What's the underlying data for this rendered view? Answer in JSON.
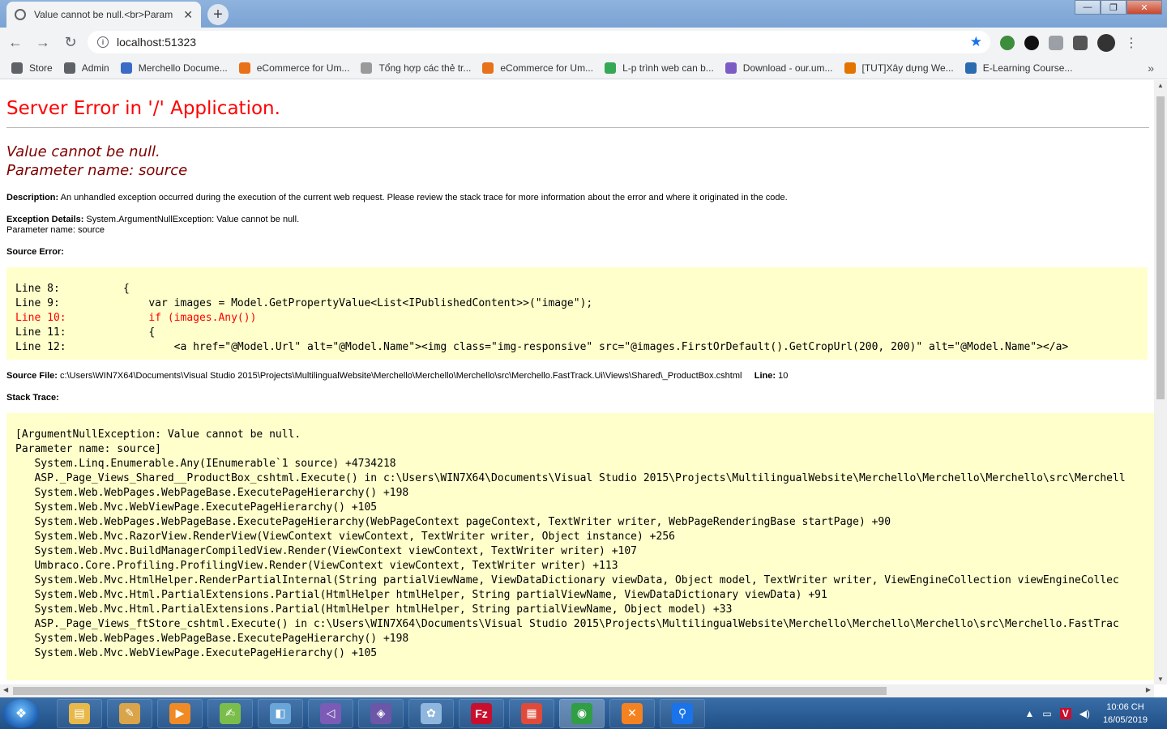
{
  "browser": {
    "tab_title": "Value cannot be null.<br>Param",
    "tab_close": "✕",
    "new_tab": "+",
    "url": "localhost:51323",
    "info": "i",
    "back": "←",
    "forward": "→",
    "reload": "↻",
    "star": "★",
    "menu": "⋮",
    "window_min": "—",
    "window_max": "❐",
    "window_close": "✕"
  },
  "bookmarks": [
    {
      "label": "Store",
      "color": "#5f6368"
    },
    {
      "label": "Admin",
      "color": "#5f6368"
    },
    {
      "label": "Merchello Docume...",
      "color": "#3b6bc5"
    },
    {
      "label": "eCommerce for Um...",
      "color": "#e8711a"
    },
    {
      "label": "Tổng hợp các thẻ tr...",
      "color": "#9a9a9a"
    },
    {
      "label": "eCommerce for Um...",
      "color": "#e8711a"
    },
    {
      "label": "L-p trình web can b...",
      "color": "#34a853"
    },
    {
      "label": "Download - our.um...",
      "color": "#7c5cc4"
    },
    {
      "label": "[TUT]Xây dựng We...",
      "color": "#e37400"
    },
    {
      "label": "E-Learning Course...",
      "color": "#2b6cb0"
    }
  ],
  "bookmarks_more": "»",
  "page": {
    "title": "Server Error in '/' Application.",
    "message_line1": "Value cannot be null.",
    "message_line2": "Parameter name: source",
    "description_label": "Description:",
    "description_text": " An unhandled exception occurred during the execution of the current web request. Please review the stack trace for more information about the error and where it originated in the code.",
    "exception_label": "Exception Details:",
    "exception_text": " System.ArgumentNullException: Value cannot be null.",
    "exception_param": "Parameter name: source",
    "source_error_label": "Source Error:",
    "source_lines": [
      {
        "text": "Line 8:          {",
        "highlight": false
      },
      {
        "text": "Line 9:              var images = Model.GetPropertyValue<List<IPublishedContent>>(\"image\");",
        "highlight": false
      },
      {
        "text": "Line 10:             if (images.Any())",
        "highlight": true
      },
      {
        "text": "Line 11:             {",
        "highlight": false
      },
      {
        "text": "Line 12:                 <a href=\"@Model.Url\" alt=\"@Model.Name\"><img class=\"img-responsive\" src=\"@images.FirstOrDefault().GetCropUrl(200, 200)\" alt=\"@Model.Name\"></a>",
        "highlight": false
      }
    ],
    "source_file_label": "Source File:",
    "source_file_path": " c:\\Users\\WIN7X64\\Documents\\Visual Studio 2015\\Projects\\MultilingualWebsite\\Merchello\\Merchello\\Merchello\\src\\Merchello.FastTrack.Ui\\Views\\Shared\\_ProductBox.cshtml",
    "line_label": "Line:",
    "line_value": " 10",
    "stack_trace_label": "Stack Trace:",
    "stack_lines": [
      "[ArgumentNullException: Value cannot be null.",
      "Parameter name: source]",
      "   System.Linq.Enumerable.Any(IEnumerable`1 source) +4734218",
      "   ASP._Page_Views_Shared__ProductBox_cshtml.Execute() in c:\\Users\\WIN7X64\\Documents\\Visual Studio 2015\\Projects\\MultilingualWebsite\\Merchello\\Merchello\\Merchello\\src\\Merchell",
      "   System.Web.WebPages.WebPageBase.ExecutePageHierarchy() +198",
      "   System.Web.Mvc.WebViewPage.ExecutePageHierarchy() +105",
      "   System.Web.WebPages.WebPageBase.ExecutePageHierarchy(WebPageContext pageContext, TextWriter writer, WebPageRenderingBase startPage) +90",
      "   System.Web.Mvc.RazorView.RenderView(ViewContext viewContext, TextWriter writer, Object instance) +256",
      "   System.Web.Mvc.BuildManagerCompiledView.Render(ViewContext viewContext, TextWriter writer) +107",
      "   Umbraco.Core.Profiling.ProfilingView.Render(ViewContext viewContext, TextWriter writer) +113",
      "   System.Web.Mvc.HtmlHelper.RenderPartialInternal(String partialViewName, ViewDataDictionary viewData, Object model, TextWriter writer, ViewEngineCollection viewEngineCollec",
      "   System.Web.Mvc.Html.PartialExtensions.Partial(HtmlHelper htmlHelper, String partialViewName, ViewDataDictionary viewData) +91",
      "   System.Web.Mvc.Html.PartialExtensions.Partial(HtmlHelper htmlHelper, String partialViewName, Object model) +33",
      "   ASP._Page_Views_ftStore_cshtml.Execute() in c:\\Users\\WIN7X64\\Documents\\Visual Studio 2015\\Projects\\MultilingualWebsite\\Merchello\\Merchello\\Merchello\\src\\Merchello.FastTrac",
      "   System.Web.WebPages.WebPageBase.ExecutePageHierarchy() +198",
      "   System.Web.Mvc.WebViewPage.ExecutePageHierarchy() +105"
    ]
  },
  "taskbar": {
    "items": [
      {
        "icon": "file-explorer-icon",
        "color": "#e8b84a",
        "glyph": "▤"
      },
      {
        "icon": "tools-icon",
        "color": "#d9a44a",
        "glyph": "✎"
      },
      {
        "icon": "media-player-icon",
        "color": "#f08a24",
        "glyph": "▶"
      },
      {
        "icon": "notepad-plus-icon",
        "color": "#7bbd4b",
        "glyph": "✍"
      },
      {
        "icon": "editor-icon",
        "color": "#6aa5d8",
        "glyph": "◧"
      },
      {
        "icon": "visual-studio-icon",
        "color": "#7b5bb6",
        "glyph": "◁"
      },
      {
        "icon": "visual-studio-2-icon",
        "color": "#6c56a8",
        "glyph": "◈"
      },
      {
        "icon": "paint-icon",
        "color": "#8fb6dd",
        "glyph": "✿"
      },
      {
        "icon": "filezilla-icon",
        "color": "#c8102e",
        "glyph": "Fz"
      },
      {
        "icon": "apps-icon",
        "color": "#e04a3a",
        "glyph": "▦"
      },
      {
        "icon": "chrome-icon",
        "color": "#2f9e44",
        "glyph": "◉"
      },
      {
        "icon": "xampp-icon",
        "color": "#f58220",
        "glyph": "✕"
      },
      {
        "icon": "maps-pin-icon",
        "color": "#1a73e8",
        "glyph": "⚲"
      }
    ],
    "time": "10:06 CH",
    "date": "16/05/2019"
  }
}
